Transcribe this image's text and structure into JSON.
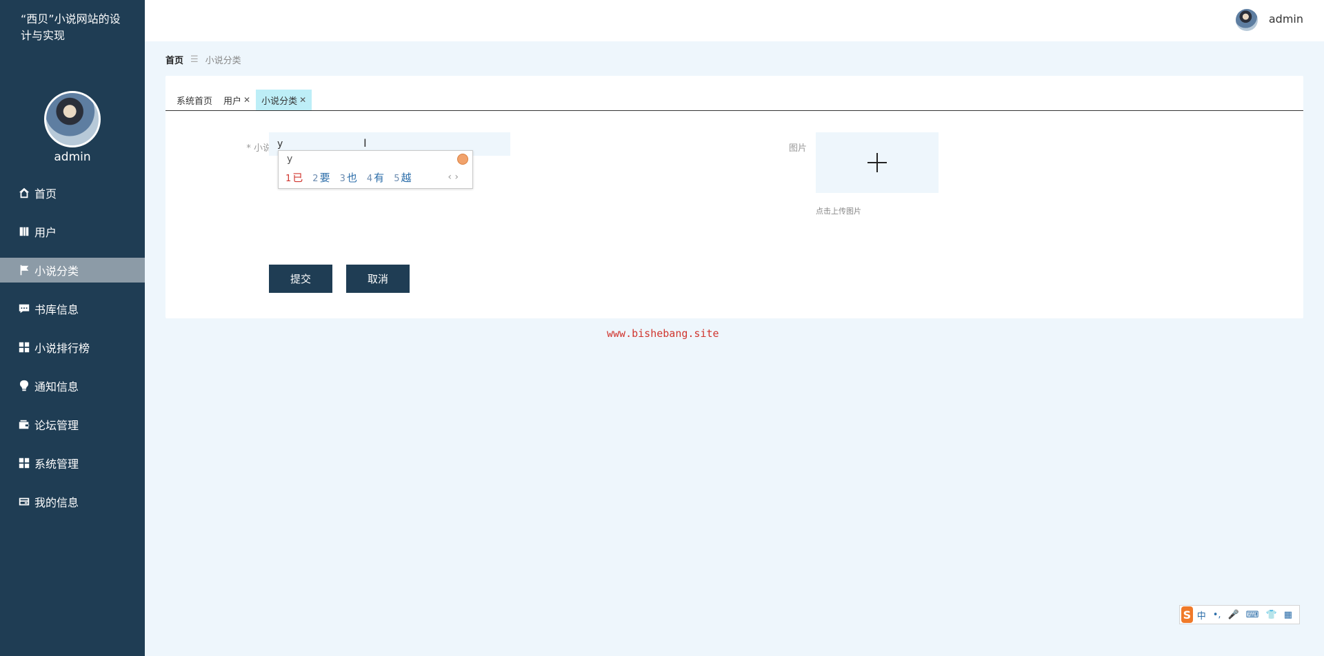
{
  "app": {
    "title": "“西贝”小说网站的设计与实现"
  },
  "sidebar": {
    "username": "admin",
    "items": [
      {
        "label": "首页",
        "icon": "home-icon"
      },
      {
        "label": "用户",
        "icon": "book-icon"
      },
      {
        "label": "小说分类",
        "icon": "flag-icon",
        "active": true
      },
      {
        "label": "书库信息",
        "icon": "chat-icon"
      },
      {
        "label": "小说排行榜",
        "icon": "grid-icon"
      },
      {
        "label": "通知信息",
        "icon": "bulb-icon"
      },
      {
        "label": "论坛管理",
        "icon": "wallet-icon"
      },
      {
        "label": "系统管理",
        "icon": "grid-icon"
      },
      {
        "label": "我的信息",
        "icon": "card-icon"
      }
    ]
  },
  "header": {
    "username": "admin"
  },
  "breadcrumb": {
    "home": "首页",
    "separator": "☰",
    "current": "小说分类"
  },
  "tabs": [
    {
      "label": "系统首页",
      "closable": false
    },
    {
      "label": "用户",
      "closable": true
    },
    {
      "label": "小说分类",
      "closable": true,
      "active": true
    }
  ],
  "form": {
    "category_label": "* 小说分类",
    "category_value": "y",
    "image_label": "图片",
    "upload_hint": "点击上传图片",
    "submit_label": "提交",
    "cancel_label": "取消"
  },
  "ime_popup": {
    "pinyin": "y",
    "candidates": [
      {
        "n": "1",
        "text": "已"
      },
      {
        "n": "2",
        "text": "要"
      },
      {
        "n": "3",
        "text": "也"
      },
      {
        "n": "4",
        "text": "有"
      },
      {
        "n": "5",
        "text": "越"
      }
    ],
    "nav": "‹ ›"
  },
  "watermark": "www.bishebang.site",
  "ime_toolbar": {
    "logo": "S",
    "mode": "中",
    "punct": "•,",
    "mic": "🎤",
    "keyboard": "⌨",
    "skin": "👕",
    "apps": "▦"
  },
  "colors": {
    "sidebar": "#1f3d54",
    "active_menu": "#8c9ba7",
    "active_tab": "#bdeef7",
    "watermark": "#d0352e"
  }
}
